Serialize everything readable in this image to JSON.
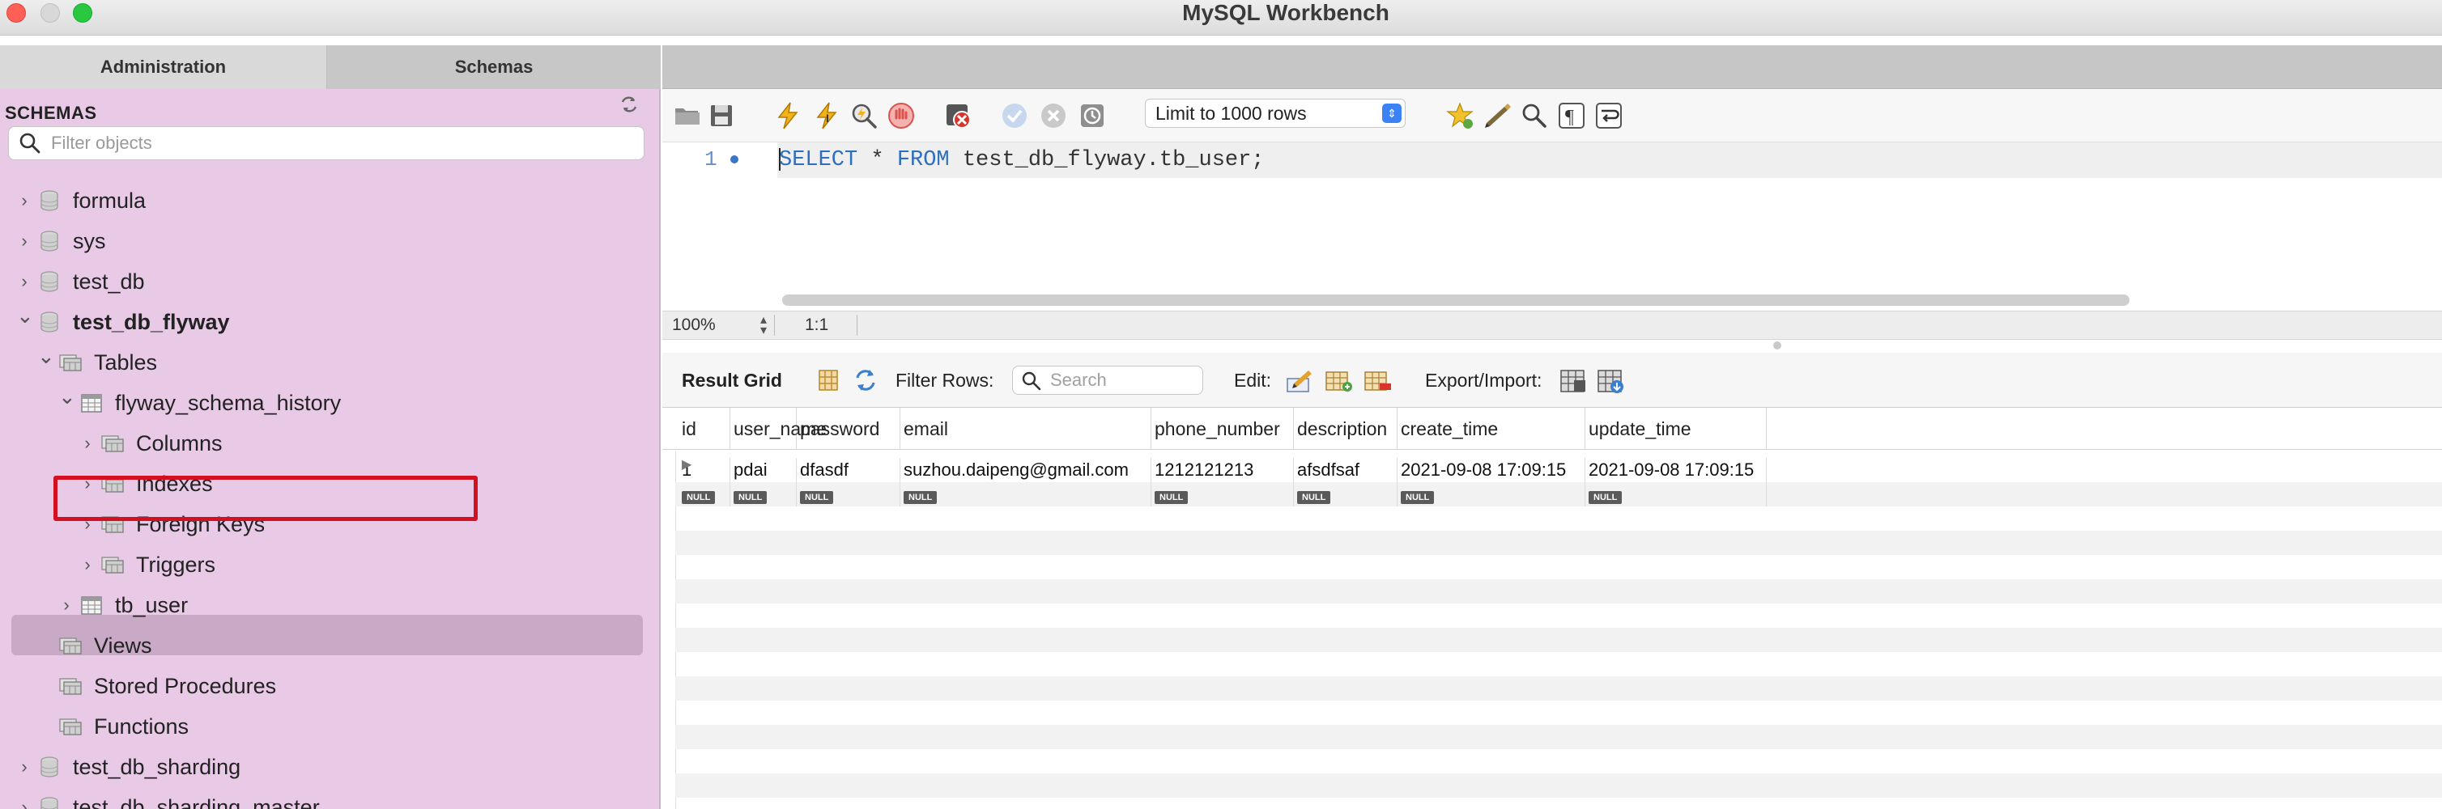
{
  "window": {
    "title": "MySQL Workbench"
  },
  "left_panel": {
    "tabs": [
      "Administration",
      "Schemas"
    ],
    "active_tab": "Schemas",
    "header": "SCHEMAS",
    "filter_placeholder": "Filter objects",
    "tree": [
      {
        "label": "formula",
        "depth": 0,
        "type": "schema",
        "expanded": false
      },
      {
        "label": "sys",
        "depth": 0,
        "type": "schema",
        "expanded": false
      },
      {
        "label": "test_db",
        "depth": 0,
        "type": "schema",
        "expanded": false
      },
      {
        "label": "test_db_flyway",
        "depth": 0,
        "type": "schema",
        "expanded": true,
        "bold": true
      },
      {
        "label": "Tables",
        "depth": 1,
        "type": "folder",
        "expanded": true
      },
      {
        "label": "flyway_schema_history",
        "depth": 2,
        "type": "table",
        "expanded": true
      },
      {
        "label": "Columns",
        "depth": 3,
        "type": "subfolder",
        "expanded": false
      },
      {
        "label": "Indexes",
        "depth": 3,
        "type": "subfolder",
        "expanded": false
      },
      {
        "label": "Foreign Keys",
        "depth": 3,
        "type": "subfolder",
        "expanded": false
      },
      {
        "label": "Triggers",
        "depth": 3,
        "type": "subfolder",
        "expanded": false
      },
      {
        "label": "tb_user",
        "depth": 2,
        "type": "table",
        "expanded": false,
        "selected": true
      },
      {
        "label": "Views",
        "depth": 1,
        "type": "folder",
        "nochev": true
      },
      {
        "label": "Stored Procedures",
        "depth": 1,
        "type": "folder",
        "nochev": true
      },
      {
        "label": "Functions",
        "depth": 1,
        "type": "folder",
        "nochev": true
      },
      {
        "label": "test_db_sharding",
        "depth": 0,
        "type": "schema",
        "expanded": false
      },
      {
        "label": "test_db_sharding_master",
        "depth": 0,
        "type": "schema",
        "expanded": false
      }
    ]
  },
  "editor": {
    "limit_label": "Limit to 1000 rows",
    "line_number": "1",
    "sql": {
      "kw1": "SELECT",
      "rest1": " * ",
      "kw2": "FROM",
      "rest2": " test_db_flyway.tb_user;"
    },
    "zoom": "100%",
    "cursor_pos": "1:1"
  },
  "result": {
    "label": "Result Grid",
    "filter_label": "Filter Rows:",
    "search_placeholder": "Search",
    "edit_label": "Edit:",
    "export_label": "Export/Import:",
    "columns": [
      "id",
      "user_name",
      "password",
      "email",
      "phone_number",
      "description",
      "create_time",
      "update_time"
    ],
    "rows": [
      [
        "1",
        "pdai",
        "dfasdf",
        "suzhou.daipeng@gmail.com",
        "1212121213",
        "afsdfsaf",
        "2021-09-08 17:09:15",
        "2021-09-08 17:09:15"
      ]
    ],
    "null_label": "NULL"
  },
  "colors": {
    "selection_outline": "#d2101f",
    "sidebar_bg": "#e8c9e6",
    "keyword": "#2e6fbd"
  }
}
